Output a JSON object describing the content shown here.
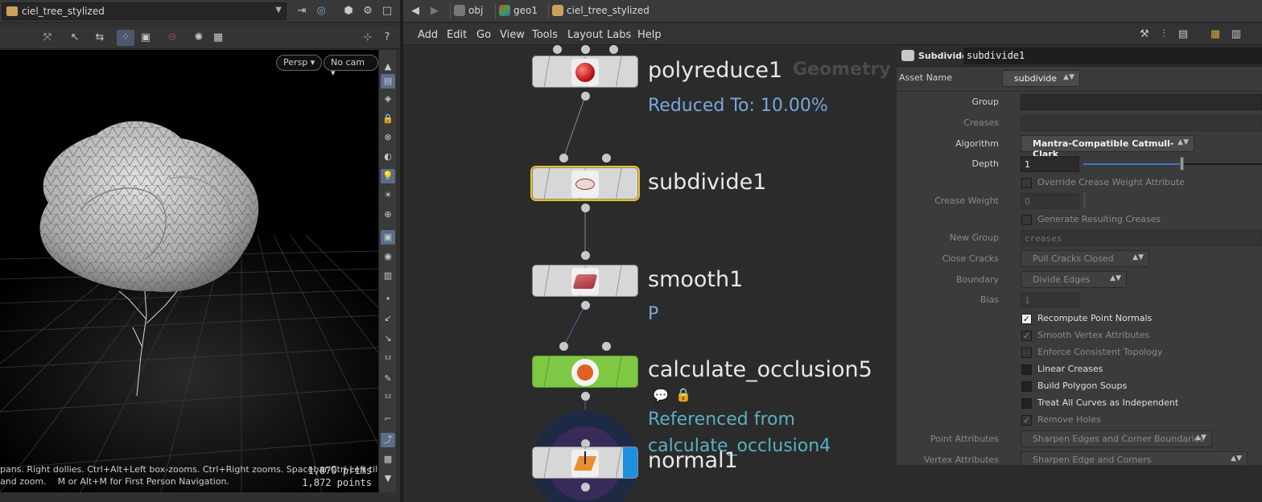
{
  "viewport_pane": {
    "path": "ciel_tree_stylized",
    "camera_persp": "Persp ▾",
    "camera_cam": "No cam ▾",
    "stats_prims": "1,870 prims",
    "stats_points": "1,872 points",
    "hint_line1": "pans. Right dollies. Ctrl+Alt+Left box-zooms. Ctrl+Right zooms. Spacebar-Ctrl-Left tilts. Hold",
    "hint_line2": "and zoom.    M or Alt+M for First Person Navigation."
  },
  "network": {
    "breadcrumbs": [
      "obj",
      "geo1",
      "ciel_tree_stylized"
    ],
    "menu": [
      "Add",
      "Edit",
      "Go",
      "View",
      "Tools",
      "Layout",
      "Labs",
      "Help"
    ],
    "context_label": "Geometry",
    "nodes": [
      {
        "name": "polyreduce1",
        "info": "Reduced To: 10.00%"
      },
      {
        "name": "subdivide1",
        "info": ""
      },
      {
        "name": "smooth1",
        "info": "P"
      },
      {
        "name": "calculate_occlusion5",
        "info": ""
      },
      {
        "name": "normal1",
        "info": ""
      }
    ],
    "reference_line1": "Referenced from",
    "reference_line2": "calculate_occlusion4"
  },
  "parameters": {
    "node_type": "Subdivide",
    "node_name": "subdivide1",
    "asset_name_label": "Asset Name",
    "asset_name_value": "subdivide",
    "group_label": "Group",
    "creases_label": "Creases",
    "algorithm_label": "Algorithm",
    "algorithm_value": "Mantra-Compatible Catmull-Clark",
    "depth_label": "Depth",
    "depth_value": "1",
    "depth_slider_fraction": 0.55,
    "override_crease": "Override Crease Weight Attribute",
    "crease_weight_label": "Crease Weight",
    "crease_weight_value": "0",
    "generate_creases": "Generate Resulting Creases",
    "new_group_label": "New Group",
    "new_group_value": "creases",
    "close_cracks_label": "Close Cracks",
    "close_cracks_value": "Pull Cracks Closed",
    "boundary_label": "Boundary",
    "boundary_value": "Divide Edges",
    "bias_label": "Bias",
    "bias_value": "1",
    "recompute_normals": "Recompute Point Normals",
    "smooth_vertex": "Smooth Vertex Attributes",
    "enforce_topology": "Enforce Consistent Topology",
    "linear_creases": "Linear Creases",
    "build_polygon_soups": "Build Polygon Soups",
    "treat_curves": "Treat All Curves as Independent",
    "remove_holes": "Remove Holes",
    "point_attr_label": "Point Attributes",
    "point_attr_value": "Sharpen Edges and Corner Boundaries",
    "vertex_attr_label": "Vertex Attributes",
    "vertex_attr_value": "Sharpen Edge and Corners"
  }
}
